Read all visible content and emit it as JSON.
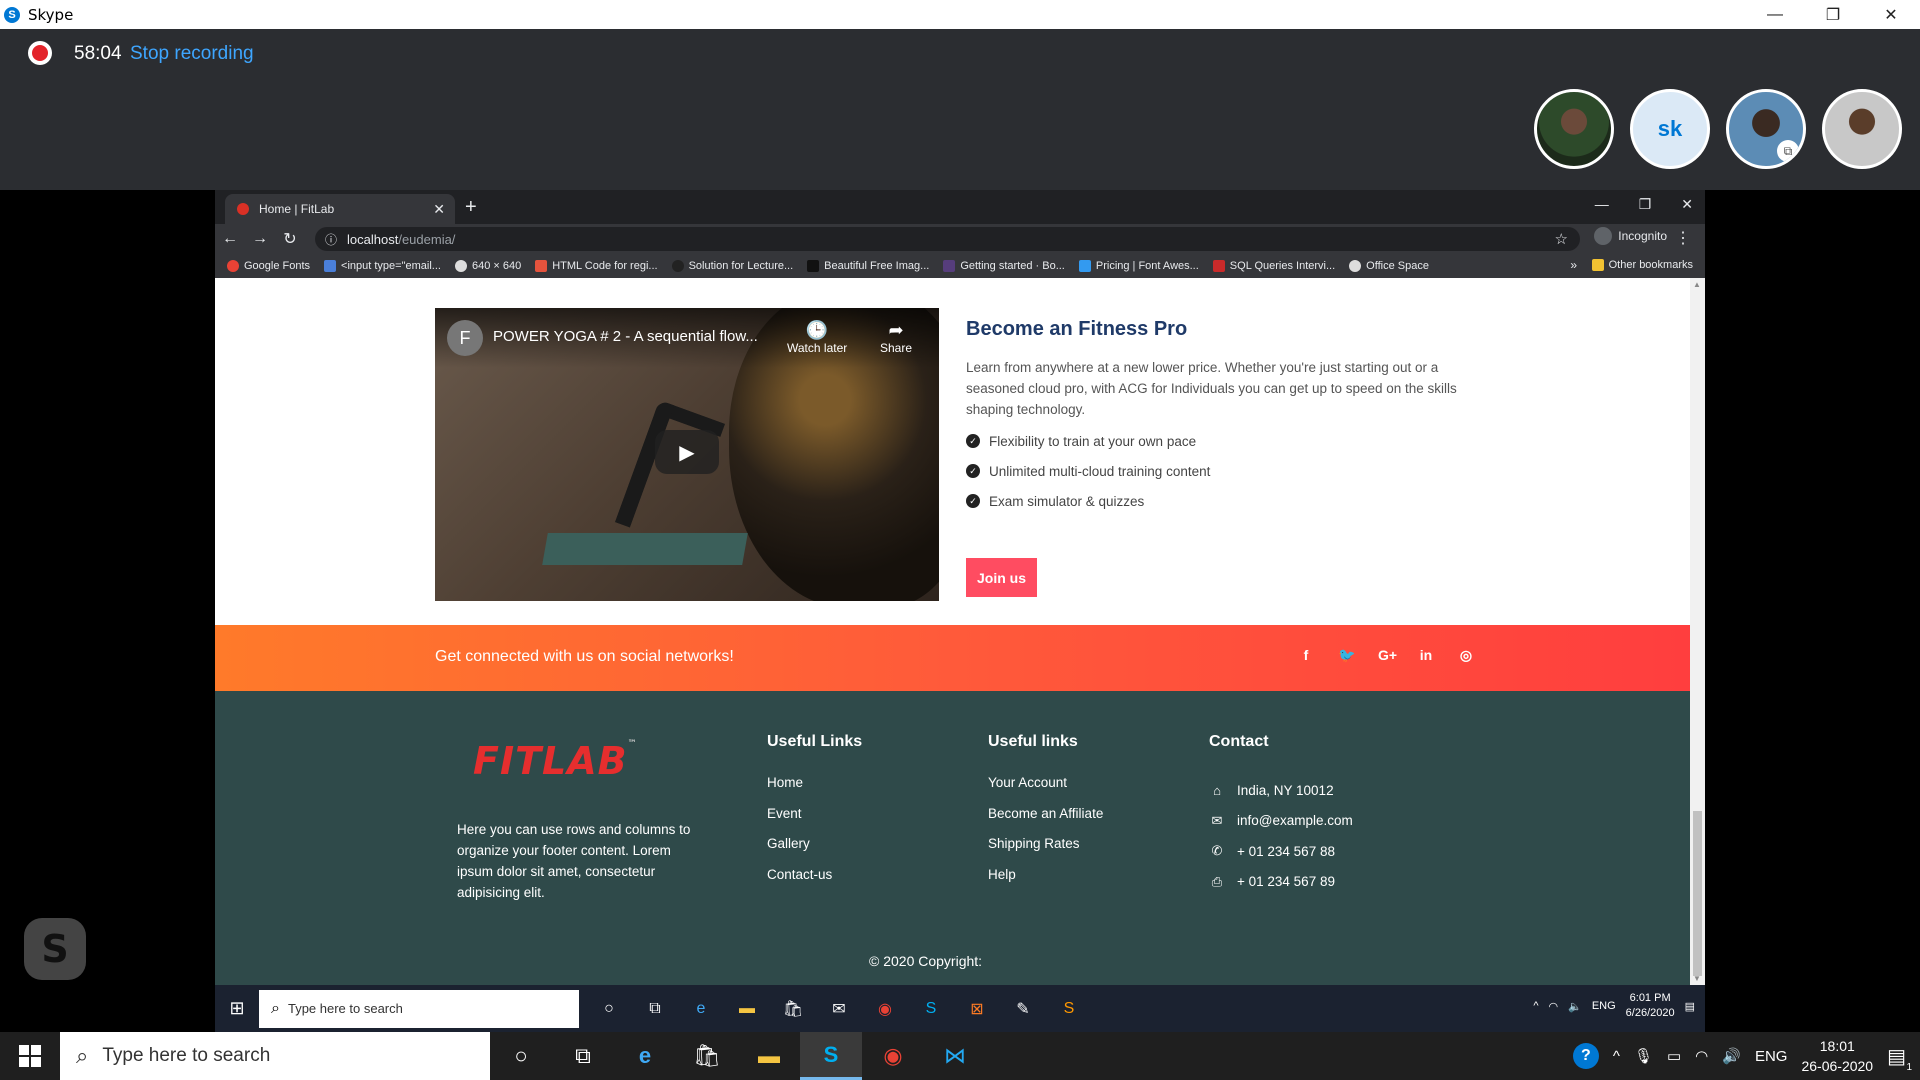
{
  "skype": {
    "title": "Skype",
    "recording_time": "58:04",
    "stop_recording": "Stop recording",
    "participant_initials": "sk"
  },
  "browser": {
    "tab_title": "Home | FitLab",
    "url_host": "localhost",
    "url_path": "/eudemia/",
    "incognito_label": "Incognito",
    "bookmarks": [
      "Google Fonts",
      "<input type=\"email...",
      "640 × 640",
      "HTML Code for regi...",
      "Solution for Lecture...",
      "Beautiful Free Imag...",
      "Getting started · Bo...",
      "Pricing | Font Awes...",
      "SQL Queries Intervi...",
      "Office Space"
    ],
    "bookmarks_more": "»",
    "other_bookmarks": "Other bookmarks"
  },
  "video": {
    "channel_initial": "F",
    "title": "POWER YOGA # 2 - A sequential flow...",
    "watch_later": "Watch later",
    "share": "Share"
  },
  "pro": {
    "title": "Become an Fitness Pro",
    "description": "Learn from anywhere at a new lower price. Whether you're just starting out or a seasoned cloud pro, with ACG for Individuals you can get up to speed on the skills shaping technology.",
    "features": [
      "Flexibility to train at your own pace",
      "Unlimited multi-cloud training content",
      "Exam simulator & quizzes"
    ],
    "cta": "Join us"
  },
  "social": {
    "text": "Get connected with us on social networks!",
    "icons": [
      "f",
      "t",
      "G+",
      "in",
      "ig"
    ]
  },
  "footer": {
    "logo": "FITLAB",
    "about": "Here you can use rows and columns to organize your footer content. Lorem ipsum dolor sit amet, consectetur adipisicing elit.",
    "col1": {
      "title": "Useful Links",
      "links": [
        "Home",
        "Event",
        "Gallery",
        "Contact-us"
      ]
    },
    "col2": {
      "title": "Useful links",
      "links": [
        "Your Account",
        "Become an Affiliate",
        "Shipping Rates",
        "Help"
      ]
    },
    "col3": {
      "title": "Contact",
      "items": [
        "India, NY 10012",
        "info@example.com",
        "+ 01 234 567 88",
        "+ 01 234 567 89"
      ]
    },
    "copyright": "© 2020 Copyright:"
  },
  "inner_taskbar": {
    "search_placeholder": "Type here to search",
    "time": "6:01 PM",
    "date": "6/26/2020",
    "lang": "ENG"
  },
  "taskbar": {
    "search_placeholder": "Type here to search",
    "lang": "ENG",
    "time": "18:01",
    "date": "26-06-2020",
    "notifications": "1"
  }
}
